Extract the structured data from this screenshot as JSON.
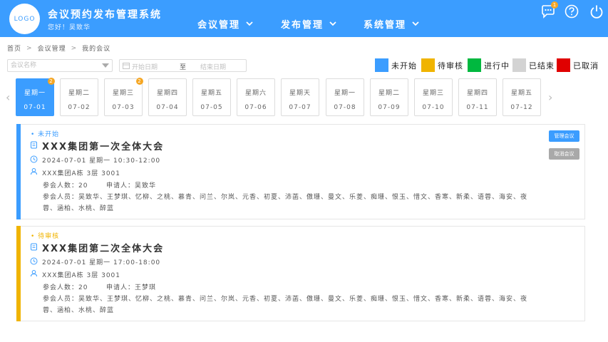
{
  "header": {
    "logo_text": "LOGO",
    "app_title": "会议预约发布管理系统",
    "greeting": "您好！吴致华",
    "nav": [
      {
        "label": "会议管理"
      },
      {
        "label": "发布管理"
      },
      {
        "label": "系统管理"
      }
    ],
    "message_badge": "1",
    "icons": [
      "message-icon",
      "help-icon",
      "power-icon"
    ]
  },
  "breadcrumb": [
    "首页",
    "会议管理",
    "我的会议"
  ],
  "filters": {
    "meeting_name_placeholder": "会议名称",
    "start_date_placeholder": "开始日期",
    "range_separator": "至",
    "end_date_placeholder": "结束日期"
  },
  "legend": [
    {
      "label": "未开始",
      "color": "#3b9dff"
    },
    {
      "label": "待审核",
      "color": "#f0b400"
    },
    {
      "label": "进行中",
      "color": "#00b83f"
    },
    {
      "label": "已结束",
      "color": "#d3d3d3"
    },
    {
      "label": "已取消",
      "color": "#e00000"
    }
  ],
  "days": [
    {
      "weekday": "星期一",
      "date": "07-01",
      "badge": "2",
      "active": true
    },
    {
      "weekday": "星期二",
      "date": "07-02",
      "badge": "",
      "active": false
    },
    {
      "weekday": "星期三",
      "date": "07-03",
      "badge": "2",
      "active": false
    },
    {
      "weekday": "星期四",
      "date": "07-04",
      "badge": "",
      "active": false
    },
    {
      "weekday": "星期五",
      "date": "07-05",
      "badge": "",
      "active": false
    },
    {
      "weekday": "星期六",
      "date": "07-06",
      "badge": "",
      "active": false
    },
    {
      "weekday": "星期天",
      "date": "07-07",
      "badge": "",
      "active": false
    },
    {
      "weekday": "星期一",
      "date": "07-08",
      "badge": "",
      "active": false
    },
    {
      "weekday": "星期二",
      "date": "07-09",
      "badge": "",
      "active": false
    },
    {
      "weekday": "星期三",
      "date": "07-10",
      "badge": "",
      "active": false
    },
    {
      "weekday": "星期四",
      "date": "07-11",
      "badge": "",
      "active": false
    },
    {
      "weekday": "星期五",
      "date": "07-12",
      "badge": "",
      "active": false
    }
  ],
  "nav_arrows": {
    "prev": "‹",
    "next": "›"
  },
  "meetings": [
    {
      "status": "• 未开始",
      "status_color": "#3b9dff",
      "title": "XXX集团第一次全体大会",
      "datetime": "2024-07-01  星期一  10:30-12:00",
      "location": "XXX集团A栋 3层 3001",
      "count": "参会人数：20",
      "applicant": "申请人：吴致华",
      "attendees": "参会人员：吴致华、王梦琪、忆柳、之桃、慕青、问兰、尔岚、元香、初夏、沛菡、傲珊、曼文、乐菱、痴珊、恨玉、惜文、香寒、新柔、语蓉、海安、夜蓉、涵柏、水桃、醉蓝",
      "buttons": [
        {
          "label": "管理会议",
          "color": "#3b9dff"
        },
        {
          "label": "取消会议",
          "color": "#a9a9a9"
        }
      ]
    },
    {
      "status": "• 待审核",
      "status_color": "#f0b400",
      "title": "XXX集团第二次全体大会",
      "datetime": "2024-07-01  星期一  17:00-18:00",
      "location": "XXX集团A栋 3层 3001",
      "count": "参会人数：20",
      "applicant": "申请人：王梦琪",
      "attendees": "参会人员：吴致华、王梦琪、忆柳、之桃、慕青、问兰、尔岚、元香、初夏、沛菡、傲珊、曼文、乐菱、痴珊、恨玉、惜文、香寒、新柔、语蓉、海安、夜蓉、涵柏、水桃、醉蓝",
      "buttons": []
    }
  ]
}
